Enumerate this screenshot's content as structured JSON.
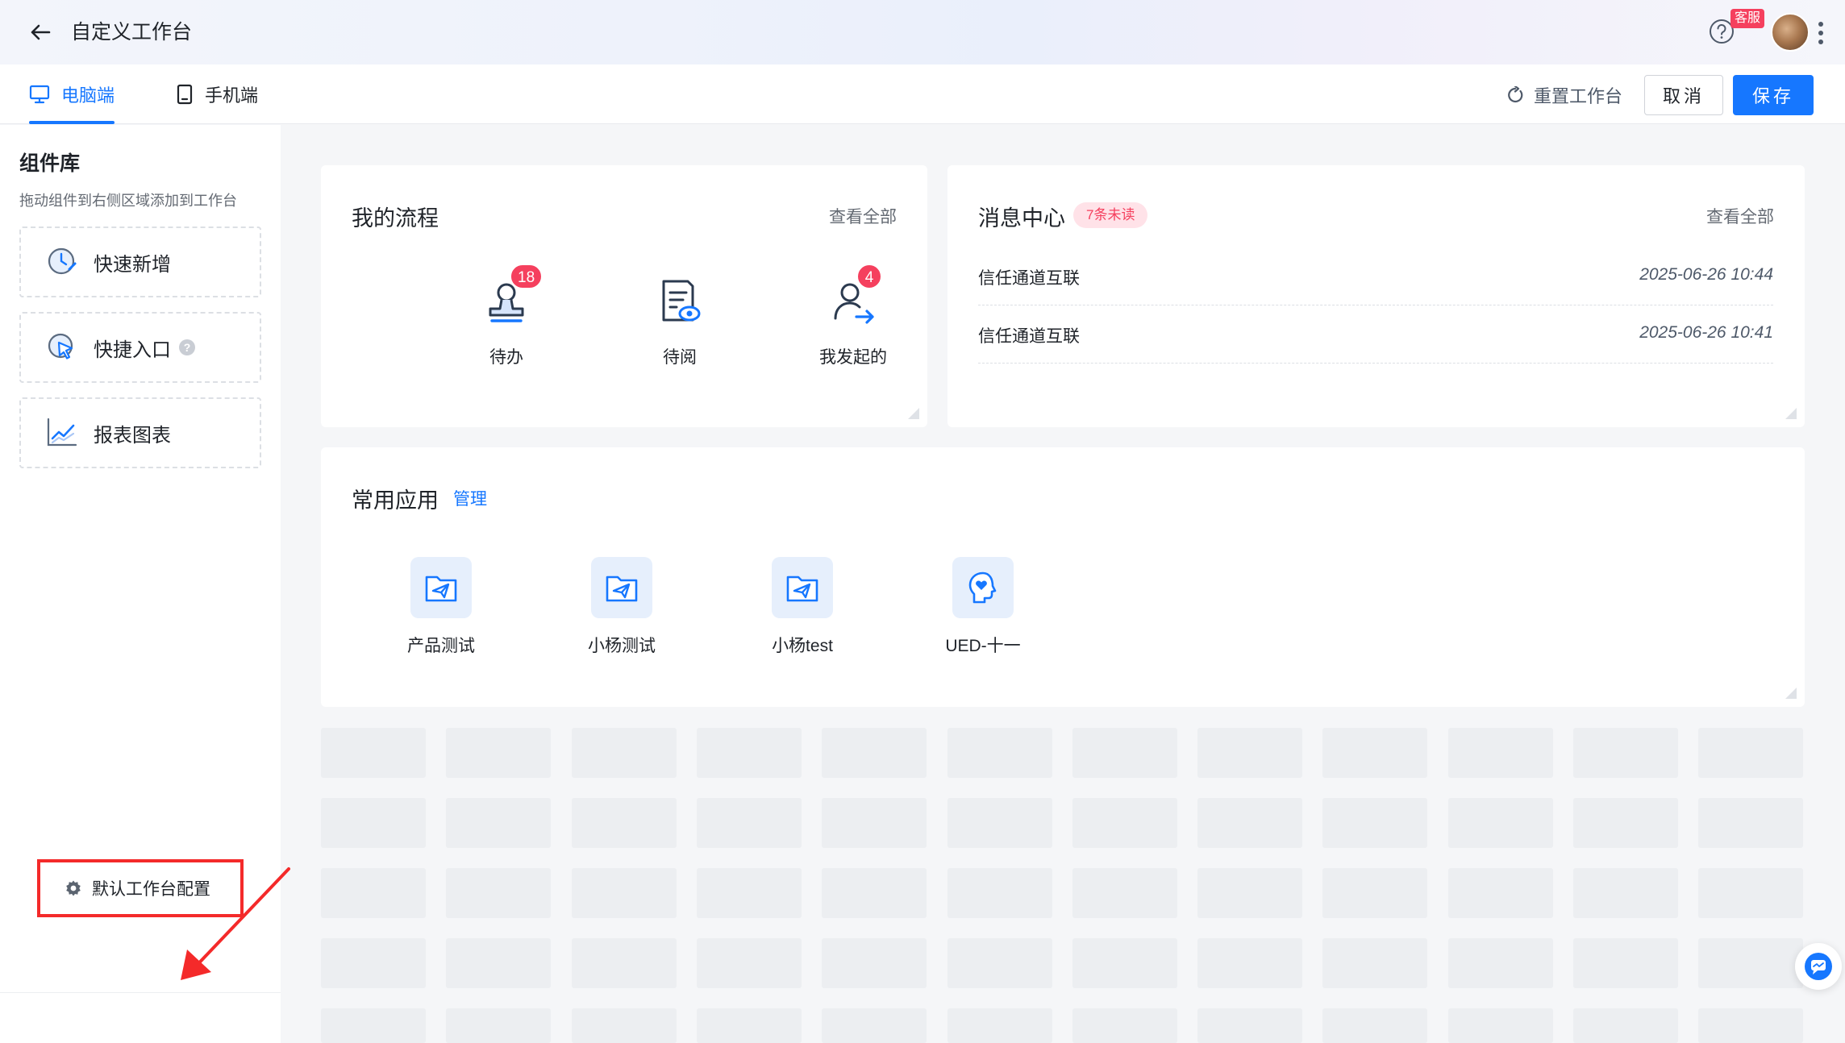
{
  "header": {
    "title": "自定义工作台",
    "help_badge": "客服"
  },
  "tabs": [
    {
      "label": "电脑端",
      "active": true
    },
    {
      "label": "手机端",
      "active": false
    }
  ],
  "toolbar": {
    "reset_label": "重置工作台",
    "cancel_label": "取消",
    "save_label": "保存"
  },
  "sidebar": {
    "title": "组件库",
    "hint": "拖动组件到右侧区域添加到工作台",
    "components": [
      {
        "label": "快速新增",
        "icon": "clock-edit-icon"
      },
      {
        "label": "快捷入口",
        "icon": "cursor-click-icon",
        "has_help": true
      },
      {
        "label": "报表图表",
        "icon": "line-chart-icon"
      }
    ],
    "help_mark": "?",
    "footer_label": "默认工作台配置"
  },
  "my_flow": {
    "title": "我的流程",
    "view_all": "查看全部",
    "items": [
      {
        "label": "待办",
        "badge": "18",
        "icon": "user-stamp-icon"
      },
      {
        "label": "待阅",
        "badge": "",
        "icon": "document-eye-icon"
      },
      {
        "label": "我发起的",
        "badge": "4",
        "icon": "user-arrow-icon"
      }
    ]
  },
  "messages": {
    "title": "消息中心",
    "unread": "7条未读",
    "view_all": "查看全部",
    "items": [
      {
        "name": "信任通道互联",
        "time": "2025-06-26 10:44"
      },
      {
        "name": "信任通道互联",
        "time": "2025-06-26 10:41"
      }
    ]
  },
  "apps": {
    "title": "常用应用",
    "manage": "管理",
    "items": [
      {
        "label": "产品测试",
        "icon": "folder-send-icon"
      },
      {
        "label": "小杨测试",
        "icon": "folder-send-icon"
      },
      {
        "label": "小杨test",
        "icon": "folder-send-icon"
      },
      {
        "label": "UED-十一",
        "icon": "head-heart-icon"
      }
    ]
  },
  "colors": {
    "accent": "#1677ff",
    "badge": "#f5405e",
    "highlight": "#f42a2a"
  }
}
